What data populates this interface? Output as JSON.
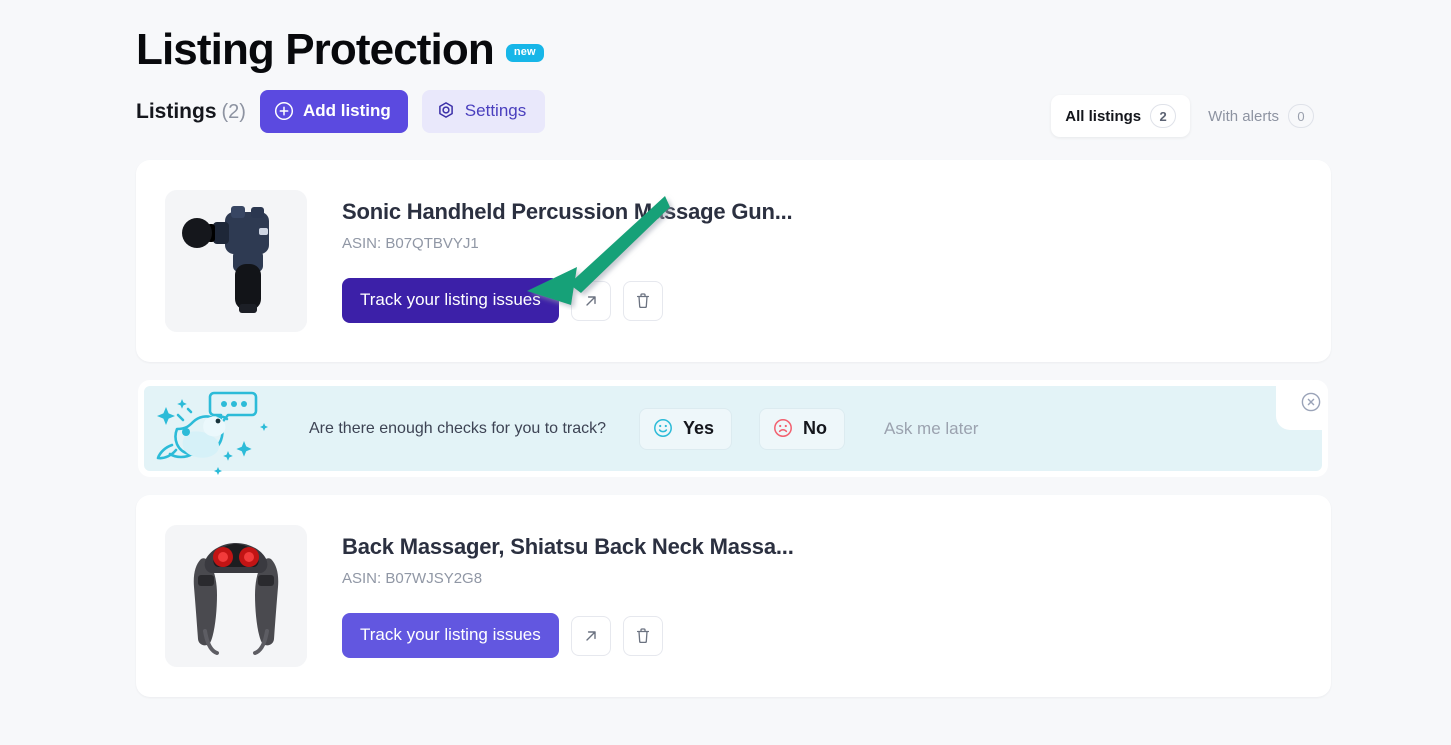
{
  "header": {
    "title": "Listing Protection",
    "badge": "new"
  },
  "toolbar": {
    "listings_label": "Listings",
    "listings_count": "(2)",
    "add_listing_label": "Add listing",
    "add_listing_icon": "plus-circle-icon",
    "settings_label": "Settings",
    "settings_icon": "gear-icon"
  },
  "filters": {
    "tabs": [
      {
        "label": "All listings",
        "count": "2",
        "active": true
      },
      {
        "label": "With alerts",
        "count": "0",
        "active": false
      }
    ]
  },
  "listings": [
    {
      "title": "Sonic Handheld Percussion Massage Gun...",
      "asin": "ASIN: B07QTBVYJ1",
      "track_label": "Track your listing issues",
      "open_icon": "external-link-icon",
      "delete_icon": "trash-icon",
      "thumb_alt": "massage-gun-product-image"
    },
    {
      "title": "Back Massager, Shiatsu Back Neck Massa...",
      "asin": "ASIN: B07WJSY2G8",
      "track_label": "Track your listing issues",
      "open_icon": "external-link-icon",
      "delete_icon": "trash-icon",
      "thumb_alt": "neck-massager-product-image"
    }
  ],
  "feedback_banner": {
    "question": "Are there enough checks for you to track?",
    "yes_label": "Yes",
    "yes_icon": "smiley-face-icon",
    "no_label": "No",
    "no_icon": "frowny-face-icon",
    "ask_later_label": "Ask me later",
    "close_icon": "close-circle-icon",
    "illustration": "bird-with-speech-bubble-illustration"
  },
  "annotation": {
    "arrow_color": "#19a178",
    "points_to": "Track your listing issues"
  },
  "colors": {
    "page_background": "#f7f8fa",
    "primary_purple": "#5b4ae0",
    "primary_purple_hover": "#3c20a8",
    "badge_cyan": "#17b6e8",
    "banner_cyan": "#e3f3f7"
  }
}
